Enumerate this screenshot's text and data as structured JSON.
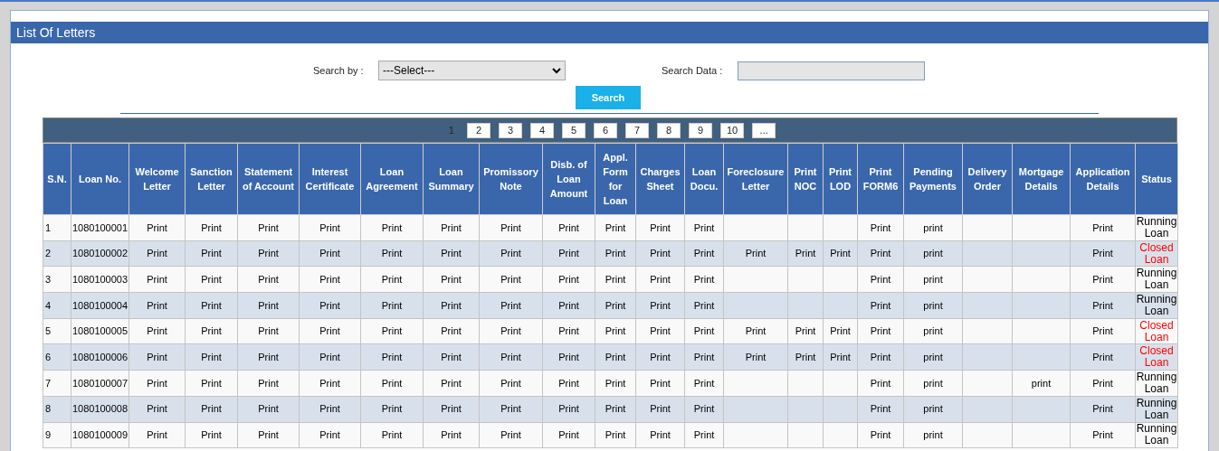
{
  "panel": {
    "title": "List Of Letters"
  },
  "search": {
    "by_label": "Search by :",
    "by_value": "---Select---",
    "data_label": "Search Data :",
    "button": "Search"
  },
  "pager": [
    {
      "label": "1",
      "selected": true
    },
    {
      "label": "2",
      "selected": false
    },
    {
      "label": "3",
      "selected": false
    },
    {
      "label": "4",
      "selected": false
    },
    {
      "label": "5",
      "selected": false
    },
    {
      "label": "6",
      "selected": false
    },
    {
      "label": "7",
      "selected": false
    },
    {
      "label": "8",
      "selected": false
    },
    {
      "label": "9",
      "selected": false
    },
    {
      "label": "10",
      "selected": false
    },
    {
      "label": "...",
      "selected": false
    }
  ],
  "table": {
    "columns": [
      "S.N.",
      "Loan No.",
      "Welcome Letter",
      "Sanction Letter",
      "Statement of Account",
      "Interest Certificate",
      "Loan Agreement",
      "Loan Summary",
      "Promissory Note",
      "Disb. of Loan Amount",
      "Appl. Form for Loan",
      "Charges Sheet",
      "Loan Docu.",
      "Foreclosure Letter",
      "Print NOC",
      "Print LOD",
      "Print FORM6",
      "Pending Payments",
      "Delivery Order",
      "Mortgage Details",
      "Application Details",
      "Status"
    ],
    "rows": [
      {
        "cells": [
          "1",
          "1080100001",
          "Print",
          "Print",
          "Print",
          "Print",
          "Print",
          "Print",
          "Print",
          "Print",
          "Print",
          "Print",
          "Print",
          "",
          "",
          "",
          "Print",
          "print",
          "",
          "",
          "Print",
          "Running Loan"
        ],
        "color": "#000000"
      },
      {
        "cells": [
          "2",
          "1080100002",
          "Print",
          "Print",
          "Print",
          "Print",
          "Print",
          "Print",
          "Print",
          "Print",
          "Print",
          "Print",
          "Print",
          "Print",
          "Print",
          "Print",
          "Print",
          "print",
          "",
          "",
          "Print",
          "Closed Loan"
        ],
        "color": "#ff0000"
      },
      {
        "cells": [
          "3",
          "1080100003",
          "Print",
          "Print",
          "Print",
          "Print",
          "Print",
          "Print",
          "Print",
          "Print",
          "Print",
          "Print",
          "Print",
          "",
          "",
          "",
          "Print",
          "print",
          "",
          "",
          "Print",
          "Running Loan"
        ],
        "color": "#000000"
      },
      {
        "cells": [
          "4",
          "1080100004",
          "Print",
          "Print",
          "Print",
          "Print",
          "Print",
          "Print",
          "Print",
          "Print",
          "Print",
          "Print",
          "Print",
          "",
          "",
          "",
          "Print",
          "print",
          "",
          "",
          "Print",
          "Running Loan"
        ],
        "color": "#000000"
      },
      {
        "cells": [
          "5",
          "1080100005",
          "Print",
          "Print",
          "Print",
          "Print",
          "Print",
          "Print",
          "Print",
          "Print",
          "Print",
          "Print",
          "Print",
          "Print",
          "Print",
          "Print",
          "Print",
          "print",
          "",
          "",
          "Print",
          "Closed Loan"
        ],
        "color": "#ff0000"
      },
      {
        "cells": [
          "6",
          "1080100006",
          "Print",
          "Print",
          "Print",
          "Print",
          "Print",
          "Print",
          "Print",
          "Print",
          "Print",
          "Print",
          "Print",
          "Print",
          "Print",
          "Print",
          "Print",
          "print",
          "",
          "",
          "Print",
          "Closed Loan"
        ],
        "color": "#ff0000"
      },
      {
        "cells": [
          "7",
          "1080100007",
          "Print",
          "Print",
          "Print",
          "Print",
          "Print",
          "Print",
          "Print",
          "Print",
          "Print",
          "Print",
          "Print",
          "",
          "",
          "",
          "Print",
          "print",
          "",
          "print",
          "Print",
          "Running Loan"
        ],
        "color": "#000000"
      },
      {
        "cells": [
          "8",
          "1080100008",
          "Print",
          "Print",
          "Print",
          "Print",
          "Print",
          "Print",
          "Print",
          "Print",
          "Print",
          "Print",
          "Print",
          "",
          "",
          "",
          "Print",
          "print",
          "",
          "",
          "Print",
          "Running Loan"
        ],
        "color": "#000000"
      },
      {
        "cells": [
          "9",
          "1080100009",
          "Print",
          "Print",
          "Print",
          "Print",
          "Print",
          "Print",
          "Print",
          "Print",
          "Print",
          "Print",
          "Print",
          "",
          "",
          "",
          "Print",
          "print",
          "",
          "",
          "Print",
          "Running Loan"
        ],
        "color": "#000000"
      }
    ]
  }
}
